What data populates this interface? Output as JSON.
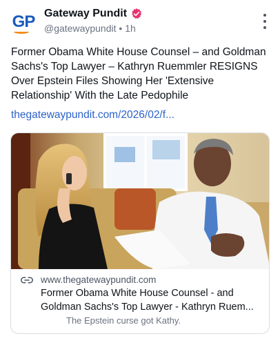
{
  "author": {
    "initials": "GP",
    "display_name": "Gateway Pundit",
    "handle": "@gatewaypundit",
    "separator": "•",
    "time": "1h"
  },
  "post": {
    "text": "Former Obama White House Counsel – and Goldman Sachs's Top Lawyer – Kathryn Ruemmler RESIGNS Over Epstein Files Showing Her 'Extensive Relationship' With the Late Pedophile",
    "link_text": "thegatewaypundit.com/2026/02/f..."
  },
  "link_card": {
    "domain": "www.thegatewaypundit.com",
    "title_line1": "Former Obama White House Counsel - and",
    "title_line2": "Goldman Sachs's Top Lawyer - Kathryn Ruem...",
    "description": "The Epstein curse got Kathy."
  },
  "icons": {
    "verified": "verified-badge-icon",
    "more": "more-vertical-icon",
    "link": "link-icon"
  },
  "colors": {
    "brand_blue": "#1b5bbd",
    "brand_orange": "#f08c1a",
    "verified_pink": "#e8336f",
    "link_blue": "#2c62c8"
  }
}
